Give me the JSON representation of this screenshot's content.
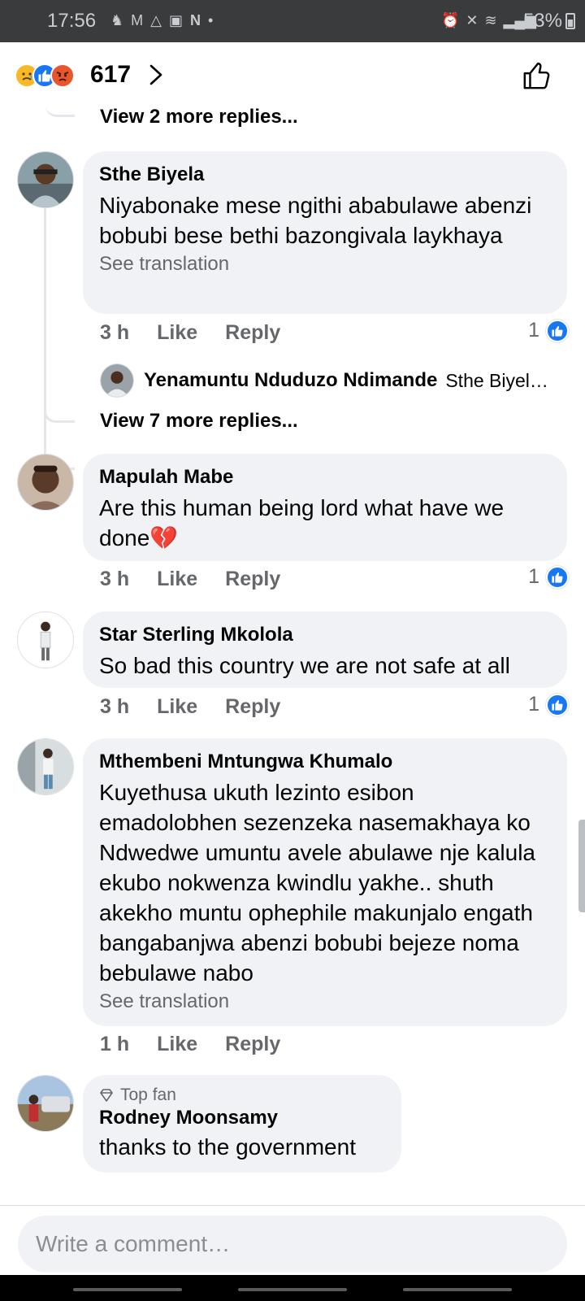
{
  "status_bar": {
    "time": "17:56",
    "battery": "53%"
  },
  "reactions": {
    "count": "617",
    "emojis": [
      "sad-reaction",
      "like-reaction",
      "angry-reaction"
    ]
  },
  "comments": {
    "view_more_top": "View 2 more replies...",
    "c1": {
      "author": "Sthe Biyela",
      "text": "Niyabonake mese ngithi ababulawe abenzi bobubi bese bethi bazongivala laykhaya",
      "see_translation": "See translation",
      "time": "3 h",
      "like": "Like",
      "reply": "Reply",
      "likes": "1",
      "reply_preview": {
        "author": "Yenamuntu Nduduzo Ndimande",
        "text": "Sthe Biyel…"
      },
      "view_more": "View 7 more replies..."
    },
    "c2": {
      "author": "Mapulah Mabe",
      "text": "Are this human being lord what have we done💔",
      "time": "3 h",
      "like": "Like",
      "reply": "Reply",
      "likes": "1"
    },
    "c3": {
      "author": "Star Sterling Mkolola",
      "text": "So bad this country we are not safe at all",
      "time": "3 h",
      "like": "Like",
      "reply": "Reply",
      "likes": "1"
    },
    "c4": {
      "author": "Mthembeni Mntungwa Khumalo",
      "text": "Kuyethusa ukuth lezinto esibon emadolobhen sezenzeka nasemakhaya ko Ndwedwe umuntu avele abulawe nje kalula ekubo nokwenza kwindlu yakhe.. shuth akekho muntu ophephile makunjalo engath bangabanjwa abenzi bobubi bejeze noma bebulawe nabo",
      "see_translation": "See translation",
      "time": "1 h",
      "like": "Like",
      "reply": "Reply"
    },
    "c5": {
      "badge": "Top fan",
      "author": "Rodney Moonsamy",
      "text": "thanks to the government"
    }
  },
  "composer": {
    "placeholder": "Write a comment…"
  },
  "colors": {
    "accent": "#1877f2",
    "bubble": "#f0f2f5",
    "secondary_text": "#65676b"
  }
}
